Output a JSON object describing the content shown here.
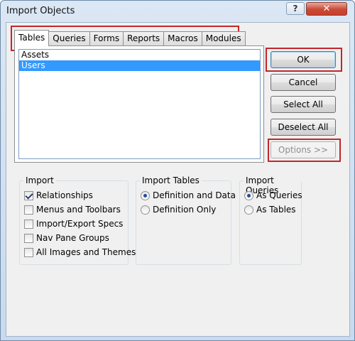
{
  "window": {
    "title": "Import Objects",
    "help_glyph": "?",
    "close_glyph": "✕"
  },
  "tabs": [
    {
      "label": "Tables",
      "active": true
    },
    {
      "label": "Queries",
      "active": false
    },
    {
      "label": "Forms",
      "active": false
    },
    {
      "label": "Reports",
      "active": false
    },
    {
      "label": "Macros",
      "active": false
    },
    {
      "label": "Modules",
      "active": false
    }
  ],
  "list": {
    "items": [
      {
        "label": "Assets",
        "selected": false
      },
      {
        "label": "Users",
        "selected": true
      }
    ]
  },
  "buttons": {
    "ok": "OK",
    "cancel": "Cancel",
    "select_all": "Select All",
    "deselect_all": "Deselect All",
    "options": "Options >>"
  },
  "import_group": {
    "title": "Import",
    "options": [
      {
        "label": "Relationships",
        "checked": true
      },
      {
        "label": "Menus and Toolbars",
        "checked": false
      },
      {
        "label": "Import/Export Specs",
        "checked": false
      },
      {
        "label": "Nav Pane Groups",
        "checked": false
      },
      {
        "label": "All Images and Themes",
        "checked": false
      }
    ]
  },
  "import_tables_group": {
    "title": "Import Tables",
    "options": [
      {
        "label": "Definition and Data",
        "checked": true
      },
      {
        "label": "Definition Only",
        "checked": false
      }
    ]
  },
  "import_queries_group": {
    "title": "Import Queries",
    "options": [
      {
        "label": "As Queries",
        "checked": true
      },
      {
        "label": "As Tables",
        "checked": false
      }
    ]
  },
  "colors": {
    "highlight_box": "#c0272d",
    "selection": "#3399ff"
  }
}
